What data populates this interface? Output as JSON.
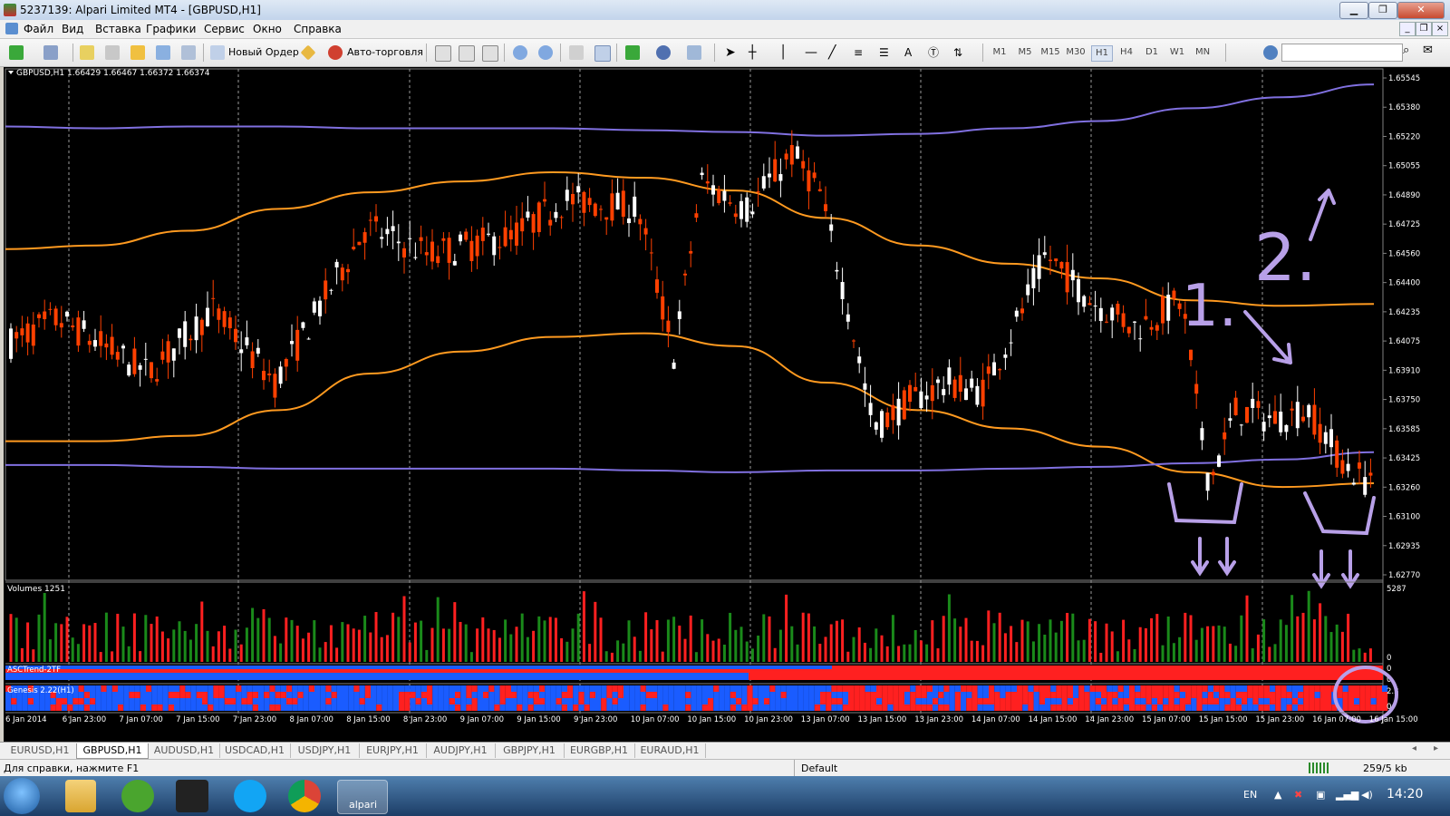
{
  "window": {
    "title": "5237139: Alpari Limited MT4 - [GBPUSD,H1]",
    "minimize": "▁",
    "restore": "❐",
    "close": "✕"
  },
  "menu": [
    "Файл",
    "Вид",
    "Вставка",
    "Графики",
    "Сервис",
    "Окно",
    "Справка"
  ],
  "toolbar": {
    "new_order": "Новый Ордер",
    "auto_trading": "Авто-торговля",
    "timeframes": [
      "M1",
      "M5",
      "M15",
      "M30",
      "H1",
      "H4",
      "D1",
      "W1",
      "MN"
    ],
    "active_timeframe": "H1"
  },
  "chart": {
    "header": "GBPUSD,H1  1.66429 1.66467 1.66372 1.66374",
    "price_ticks": [
      "1.65545",
      "1.65380",
      "1.65220",
      "1.65055",
      "1.64890",
      "1.64725",
      "1.64560",
      "1.64400",
      "1.64235",
      "1.64075",
      "1.63910",
      "1.63750",
      "1.63585",
      "1.63425",
      "1.63260",
      "1.63100",
      "1.62935",
      "1.62770"
    ],
    "time_ticks": [
      "6 Jan 2014",
      "6 Jan 23:00",
      "7 Jan 07:00",
      "7 Jan 15:00",
      "7 Jan 23:00",
      "8 Jan 07:00",
      "8 Jan 15:00",
      "8 Jan 23:00",
      "9 Jan 07:00",
      "9 Jan 15:00",
      "9 Jan 23:00",
      "10 Jan 07:00",
      "10 Jan 15:00",
      "10 Jan 23:00",
      "13 Jan 07:00",
      "13 Jan 15:00",
      "13 Jan 23:00",
      "14 Jan 07:00",
      "14 Jan 15:00",
      "14 Jan 23:00",
      "15 Jan 07:00",
      "15 Jan 15:00",
      "15 Jan 23:00",
      "16 Jan 07:00",
      "16 Jan 15:00"
    ],
    "volumes_label": "Volumes 1251",
    "volume_max": "5287",
    "volume_min": "0",
    "asc_label": "ASCTrend-2TF",
    "asc_ticks": [
      "0",
      "0"
    ],
    "genesis_label": "Genesis 2.22(H1)",
    "genesis_ticks": [
      "2.3",
      "0"
    ],
    "annotations": {
      "one": "1.",
      "two": "2."
    },
    "colors": {
      "bg": "#000000",
      "bull": "#ffffff",
      "bear": "#ff4000",
      "band": "#ff9a20",
      "channel": "#8070e0",
      "vol_up": "#1a8a1a",
      "vol_down": "#ff2020",
      "ind_red": "#ff2020",
      "ind_blue": "#1a5cff"
    }
  },
  "chart_data": {
    "type": "candlestick",
    "symbol": "GBPUSD",
    "timeframe": "H1",
    "ylim": [
      1.6277,
      1.65545
    ],
    "last_bar": {
      "open": 1.66429,
      "high": 1.66467,
      "low": 1.66372,
      "close": 1.66374
    },
    "series": [
      {
        "name": "upper channel",
        "values": [
          1.6525,
          1.6524,
          1.6525,
          1.6525,
          1.6524,
          1.6524,
          1.6524,
          1.6523,
          1.6522,
          1.652,
          1.6521,
          1.6524,
          1.6528,
          1.6535,
          1.6541,
          1.6548
        ]
      },
      {
        "name": "upper band",
        "values": [
          1.6458,
          1.646,
          1.6468,
          1.648,
          1.6489,
          1.6495,
          1.65,
          1.6497,
          1.649,
          1.6475,
          1.646,
          1.645,
          1.6442,
          1.643,
          1.6427,
          1.6428
        ]
      },
      {
        "name": "lower band",
        "values": [
          1.6353,
          1.6353,
          1.6356,
          1.637,
          1.639,
          1.6402,
          1.641,
          1.6412,
          1.6405,
          1.6385,
          1.637,
          1.636,
          1.635,
          1.6336,
          1.6328,
          1.633
        ]
      },
      {
        "name": "lower channel",
        "values": [
          1.634,
          1.634,
          1.6339,
          1.6338,
          1.6338,
          1.6338,
          1.6338,
          1.6337,
          1.6336,
          1.6337,
          1.6337,
          1.6338,
          1.6339,
          1.6341,
          1.6343,
          1.6347
        ]
      }
    ]
  },
  "tabs": [
    "EURUSD,H1",
    "GBPUSD,H1",
    "AUDUSD,H1",
    "USDCAD,H1",
    "USDJPY,H1",
    "EURJPY,H1",
    "AUDJPY,H1",
    "GBPJPY,H1",
    "EURGBP,H1",
    "EURAUD,H1"
  ],
  "active_tab": "GBPUSD,H1",
  "status": {
    "help": "Для справки, нажмите F1",
    "profile": "Default",
    "traffic": "259/5 kb"
  },
  "taskbar": {
    "lang": "EN",
    "time": "14:20",
    "active_app": "alpari"
  }
}
